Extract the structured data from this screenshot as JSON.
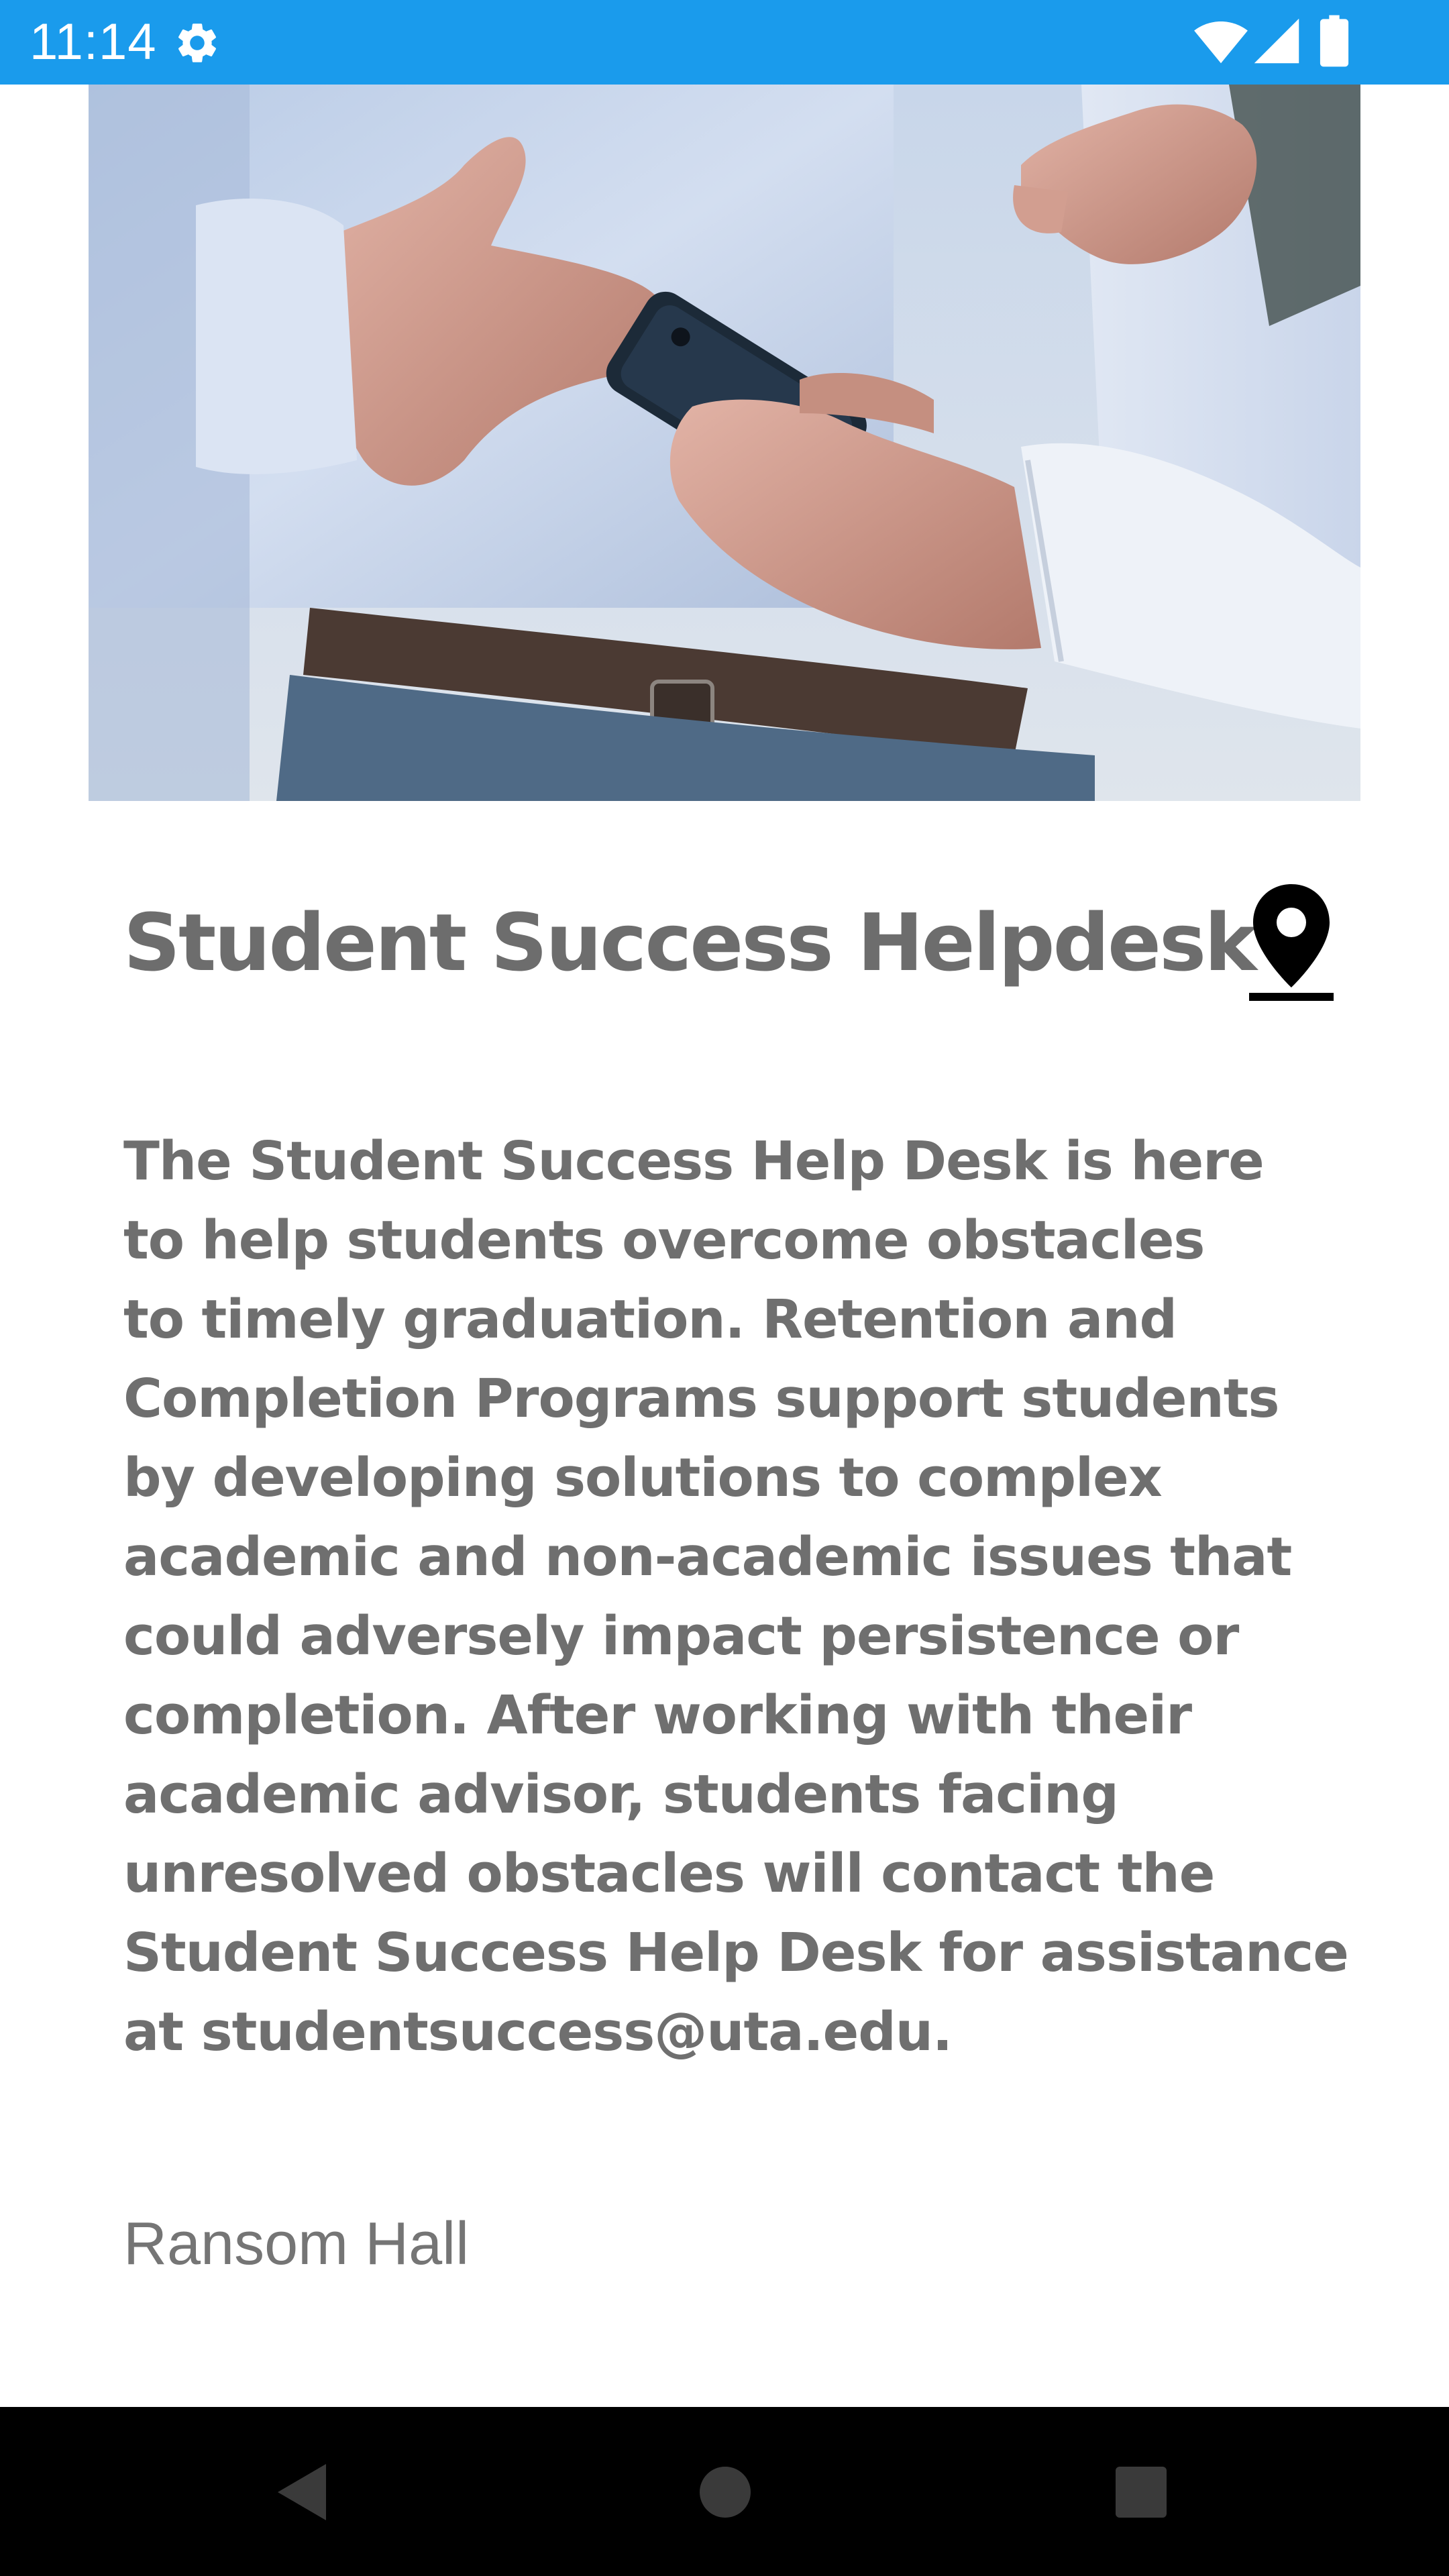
{
  "status_bar": {
    "time": "11:14",
    "icons": [
      "settings-gear-icon",
      "wifi-icon",
      "cell-signal-icon",
      "battery-icon"
    ],
    "background_color": "#1a9bec"
  },
  "hero_image": {
    "subject": "hands holding a smartphone"
  },
  "title": "Student Success Helpdesk",
  "location_button": {
    "icon": "map-pin-icon"
  },
  "description_lines": [
    "The Student Success Help Desk is here",
    "to help students overcome obstacles",
    "to timely graduation. Retention and",
    "Completion Programs support students",
    "by developing solutions to complex",
    "academic and non-academic issues that",
    "could adversely impact persistence or",
    "completion. After working with their",
    "academic advisor, students facing",
    "unresolved obstacles will contact the",
    "Student Success Help Desk for assistance",
    "at studentsuccess@uta.edu."
  ],
  "location": "Ransom Hall",
  "nav_bar": {
    "buttons": [
      "back-icon",
      "home-icon",
      "recents-icon"
    ]
  },
  "colors": {
    "title_text": "#6d6d6d",
    "body_text": "#6f6f6f",
    "nav_bar": "#000000"
  }
}
